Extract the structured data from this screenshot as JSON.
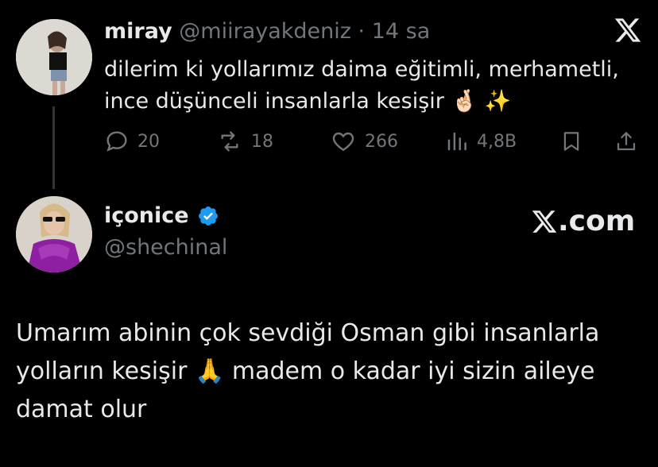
{
  "tweet1": {
    "name": "miray",
    "handle": "@miirayakdeniz",
    "separator": "·",
    "time": "14 sa",
    "text": "dilerim ki yollarımız daima eğitimli, merhametli, ince düşünceli insanlarla kesişir",
    "emojis": "🤞🏻 ✨",
    "replies": "20",
    "reposts": "18",
    "likes": "266",
    "views": "4,8B"
  },
  "tweet2": {
    "name": "içonice",
    "handle": "@shechinal",
    "watermark": ".com",
    "text_part1": "Umarım abinin çok sevdiği Osman gibi insanlarla yolların kesişir",
    "emoji": "🙏",
    "text_part2": "madem o kadar iyi sizin aileye damat olur"
  },
  "colors": {
    "background": "#000000",
    "text": "#e7e9ea",
    "muted": "#71767b",
    "verified": "#1d9bf0"
  }
}
